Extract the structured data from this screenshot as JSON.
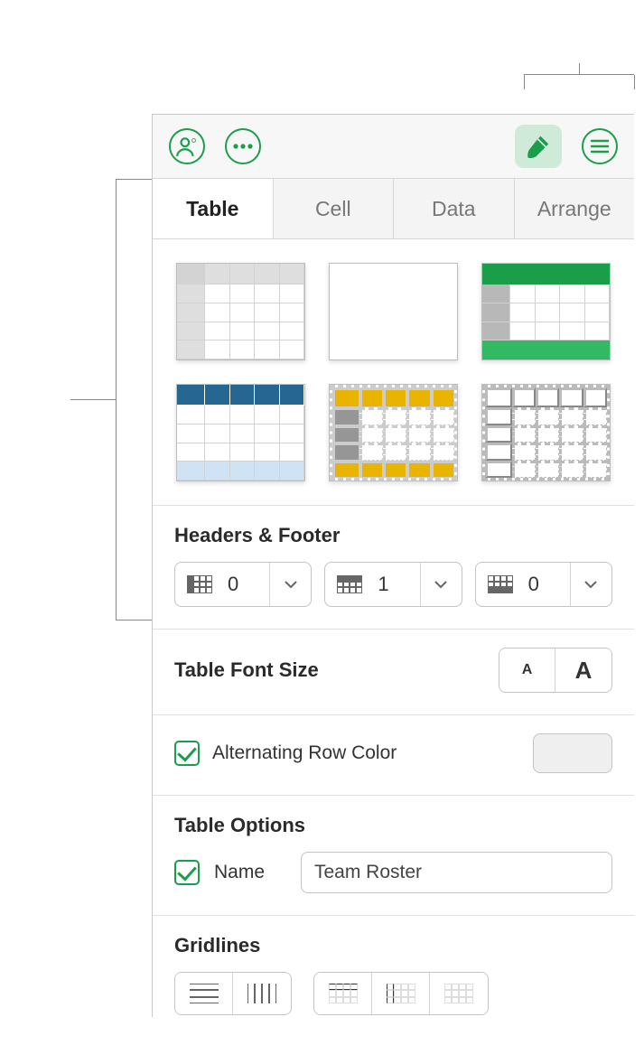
{
  "tabs": {
    "table": "Table",
    "cell": "Cell",
    "data": "Data",
    "arrange": "Arrange"
  },
  "headers_footer": {
    "title": "Headers & Footer",
    "header_cols": "0",
    "header_rows": "1",
    "footer_rows": "0"
  },
  "font_size": {
    "label": "Table Font Size"
  },
  "alt_row": {
    "label": "Alternating Row Color"
  },
  "table_options": {
    "title": "Table Options",
    "name_label": "Name",
    "name_value": "Team Roster"
  },
  "gridlines": {
    "title": "Gridlines"
  }
}
